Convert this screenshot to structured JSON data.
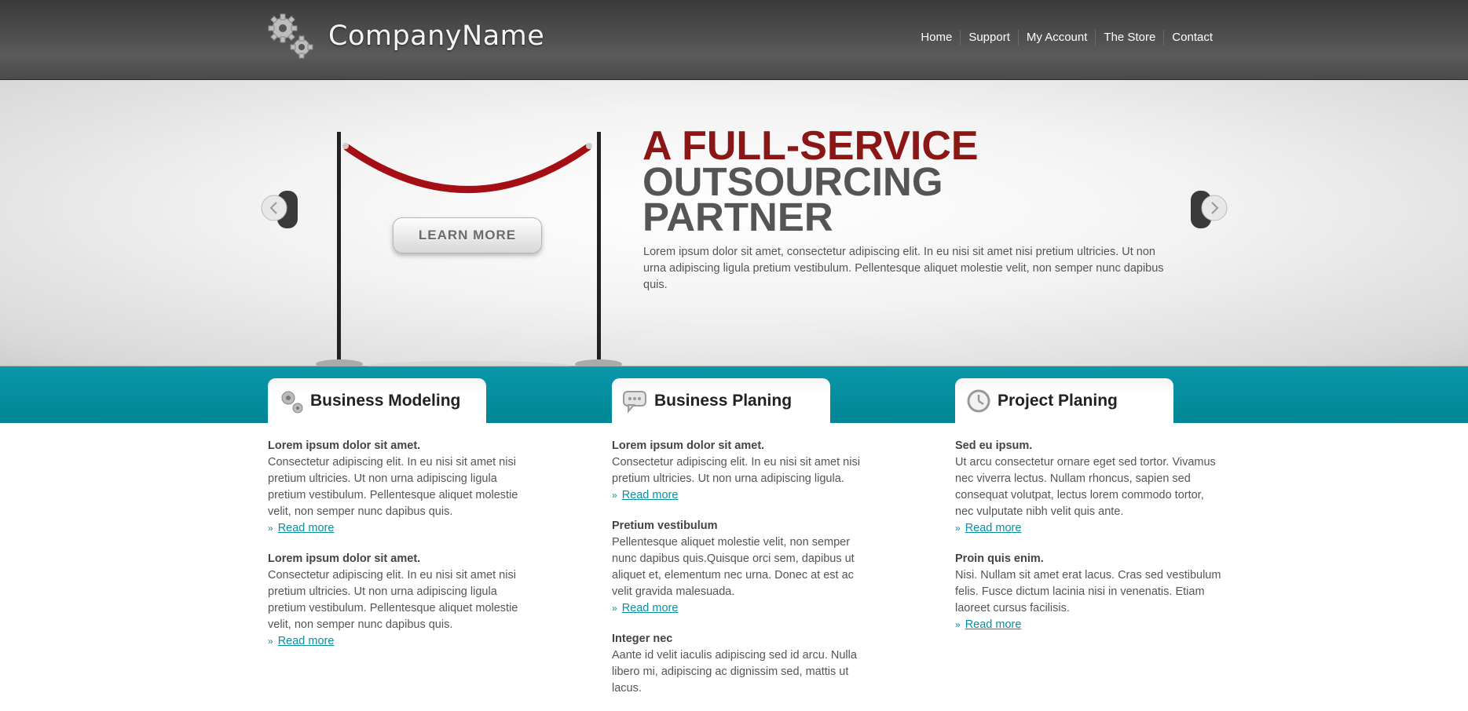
{
  "header": {
    "company": "CompanyName",
    "nav": [
      "Home",
      "Support",
      "My Account",
      "The Store",
      "Contact"
    ]
  },
  "hero": {
    "button": "LEARN MORE",
    "headline1": "A FULL-SERVICE",
    "headline2": "OUTSOURCING",
    "headline3": "PARTNER",
    "text": "Lorem ipsum dolor sit amet, consectetur adipiscing elit. In eu nisi sit amet nisi pretium ultricies. Ut non urna adipiscing ligula pretium vestibulum. Pellentesque aliquet molestie velit, non semper nunc dapibus quis."
  },
  "columns": [
    {
      "tab": "Business Modeling",
      "icon": "gears-icon",
      "items": [
        {
          "title": "Lorem ipsum dolor sit amet.",
          "text": "Consectetur adipiscing elit. In eu nisi sit amet nisi pretium ultricies. Ut non urna adipiscing ligula pretium vestibulum. Pellentesque aliquet molestie velit, non semper nunc dapibus quis.",
          "link": "Read more"
        },
        {
          "title": "Lorem ipsum dolor sit amet.",
          "text": "Consectetur adipiscing elit. In eu nisi sit amet nisi pretium ultricies. Ut non urna adipiscing ligula pretium vestibulum. Pellentesque aliquet molestie velit, non semper nunc dapibus quis.",
          "link": "Read more"
        }
      ]
    },
    {
      "tab": "Business Planing",
      "icon": "speech-bubble-icon",
      "items": [
        {
          "title": "Lorem ipsum dolor sit amet.",
          "text": "Consectetur adipiscing elit. In eu nisi sit amet nisi pretium ultricies. Ut non urna adipiscing ligula.",
          "link": "Read more"
        },
        {
          "title": "Pretium vestibulum",
          "text": "Pellentesque aliquet molestie velit, non semper nunc dapibus quis.Quisque orci sem, dapibus ut aliquet et, elementum nec urna. Donec at est ac velit gravida malesuada.",
          "link": "Read more"
        },
        {
          "title": "Integer nec",
          "text": "Aante id velit iaculis adipiscing sed id arcu. Nulla libero mi, adipiscing ac dignissim sed, mattis ut lacus."
        }
      ]
    },
    {
      "tab": "Project Planing",
      "icon": "clock-icon",
      "items": [
        {
          "title": "Sed eu ipsum.",
          "text": "Ut arcu consectetur ornare eget sed tortor. Vivamus nec viverra lectus. Nullam rhoncus, sapien sed consequat volutpat, lectus lorem commodo tortor, nec vulputate nibh velit quis ante.",
          "link": "Read more"
        },
        {
          "title": "Proin quis enim.",
          "text": "Nisi. Nullam sit amet erat lacus. Cras sed vestibulum felis. Fusce dictum lacinia nisi in venenatis. Etiam laoreet cursus facilisis.",
          "link": "Read more"
        }
      ]
    }
  ],
  "colors": {
    "teal": "#0a98aa",
    "headline_red": "#8b1616",
    "header_dark": "#4a4a4a"
  }
}
